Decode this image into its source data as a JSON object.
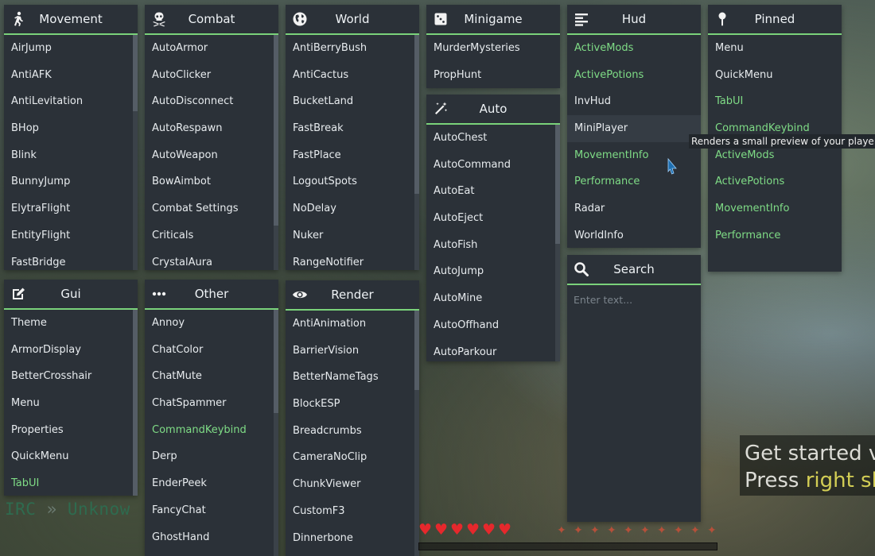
{
  "panels": {
    "movement": {
      "title": "Movement",
      "icon": "running-person-icon",
      "items": [
        {
          "label": "AirJump",
          "on": false
        },
        {
          "label": "AntiAFK",
          "on": false
        },
        {
          "label": "AntiLevitation",
          "on": false
        },
        {
          "label": "BHop",
          "on": false
        },
        {
          "label": "Blink",
          "on": false
        },
        {
          "label": "BunnyJump",
          "on": false
        },
        {
          "label": "ElytraFlight",
          "on": false
        },
        {
          "label": "EntityFlight",
          "on": false
        },
        {
          "label": "FastBridge",
          "on": false
        }
      ]
    },
    "combat": {
      "title": "Combat",
      "icon": "skull-crossbones-icon",
      "items": [
        {
          "label": "AutoArmor",
          "on": false
        },
        {
          "label": "AutoClicker",
          "on": false
        },
        {
          "label": "AutoDisconnect",
          "on": false
        },
        {
          "label": "AutoRespawn",
          "on": false
        },
        {
          "label": "AutoWeapon",
          "on": false
        },
        {
          "label": "BowAimbot",
          "on": false
        },
        {
          "label": "Combat Settings",
          "on": false
        },
        {
          "label": "Criticals",
          "on": false
        },
        {
          "label": "CrystalAura",
          "on": false
        }
      ]
    },
    "world": {
      "title": "World",
      "icon": "globe-icon",
      "items": [
        {
          "label": "AntiBerryBush",
          "on": false
        },
        {
          "label": "AntiCactus",
          "on": false
        },
        {
          "label": "BucketLand",
          "on": false
        },
        {
          "label": "FastBreak",
          "on": false
        },
        {
          "label": "FastPlace",
          "on": false
        },
        {
          "label": "LogoutSpots",
          "on": false
        },
        {
          "label": "NoDelay",
          "on": false
        },
        {
          "label": "Nuker",
          "on": false
        },
        {
          "label": "RangeNotifier",
          "on": false
        }
      ]
    },
    "minigame": {
      "title": "Minigame",
      "icon": "dice-icon",
      "items": [
        {
          "label": "MurderMysteries",
          "on": false
        },
        {
          "label": "PropHunt",
          "on": false
        }
      ]
    },
    "auto": {
      "title": "Auto",
      "icon": "magic-wand-icon",
      "items": [
        {
          "label": "AutoChest",
          "on": false
        },
        {
          "label": "AutoCommand",
          "on": false
        },
        {
          "label": "AutoEat",
          "on": false
        },
        {
          "label": "AutoEject",
          "on": false
        },
        {
          "label": "AutoFish",
          "on": false
        },
        {
          "label": "AutoJump",
          "on": false
        },
        {
          "label": "AutoMine",
          "on": false
        },
        {
          "label": "AutoOffhand",
          "on": false
        },
        {
          "label": "AutoParkour",
          "on": false
        }
      ]
    },
    "hud": {
      "title": "Hud",
      "icon": "align-left-icon",
      "items": [
        {
          "label": "ActiveMods",
          "on": true
        },
        {
          "label": "ActivePotions",
          "on": true
        },
        {
          "label": "InvHud",
          "on": false
        },
        {
          "label": "MiniPlayer",
          "on": false
        },
        {
          "label": "MovementInfo",
          "on": true
        },
        {
          "label": "Performance",
          "on": true
        },
        {
          "label": "Radar",
          "on": false
        },
        {
          "label": "WorldInfo",
          "on": false
        }
      ]
    },
    "pinned": {
      "title": "Pinned",
      "icon": "pin-icon",
      "items": [
        {
          "label": "Menu",
          "on": false
        },
        {
          "label": "QuickMenu",
          "on": false
        },
        {
          "label": "TabUI",
          "on": true
        },
        {
          "label": "CommandKeybind",
          "on": true
        },
        {
          "label": "ActiveMods",
          "on": true
        },
        {
          "label": "ActivePotions",
          "on": true
        },
        {
          "label": "MovementInfo",
          "on": true
        },
        {
          "label": "Performance",
          "on": true
        }
      ]
    },
    "gui": {
      "title": "Gui",
      "icon": "edit-icon",
      "items": [
        {
          "label": "Theme",
          "on": false
        },
        {
          "label": "ArmorDisplay",
          "on": false
        },
        {
          "label": "BetterCrosshair",
          "on": false
        },
        {
          "label": "Menu",
          "on": false
        },
        {
          "label": "Properties",
          "on": false
        },
        {
          "label": "QuickMenu",
          "on": false
        },
        {
          "label": "TabUI",
          "on": true
        }
      ]
    },
    "other": {
      "title": "Other",
      "icon": "ellipsis-icon",
      "items": [
        {
          "label": "Annoy",
          "on": false
        },
        {
          "label": "ChatColor",
          "on": false
        },
        {
          "label": "ChatMute",
          "on": false
        },
        {
          "label": "ChatSpammer",
          "on": false
        },
        {
          "label": "CommandKeybind",
          "on": true
        },
        {
          "label": "Derp",
          "on": false
        },
        {
          "label": "EnderPeek",
          "on": false
        },
        {
          "label": "FancyChat",
          "on": false
        },
        {
          "label": "GhostHand",
          "on": false
        }
      ]
    },
    "render": {
      "title": "Render",
      "icon": "eye-icon",
      "items": [
        {
          "label": "AntiAnimation",
          "on": false
        },
        {
          "label": "BarrierVision",
          "on": false
        },
        {
          "label": "BetterNameTags",
          "on": false
        },
        {
          "label": "BlockESP",
          "on": false
        },
        {
          "label": "Breadcrumbs",
          "on": false
        },
        {
          "label": "CameraNoClip",
          "on": false
        },
        {
          "label": "ChunkViewer",
          "on": false
        },
        {
          "label": "CustomF3",
          "on": false
        },
        {
          "label": "Dinnerbone",
          "on": false
        }
      ]
    },
    "search": {
      "title": "Search",
      "icon": "search-icon",
      "placeholder": "Enter text..."
    }
  },
  "tooltip": {
    "text": "Renders a small preview of your player"
  },
  "irc": {
    "prefix": "IRC",
    "separator": "»",
    "name": "Unknow"
  },
  "toast": {
    "line1": "Get started v",
    "line2_pre": "Press ",
    "line2_hl": "right sh"
  },
  "hotbar": {
    "hearts": 6,
    "food": 10
  },
  "colors": {
    "accent": "#7ad27a",
    "enabled_text": "#7fdc86",
    "panel_bg": "#2b3138"
  }
}
